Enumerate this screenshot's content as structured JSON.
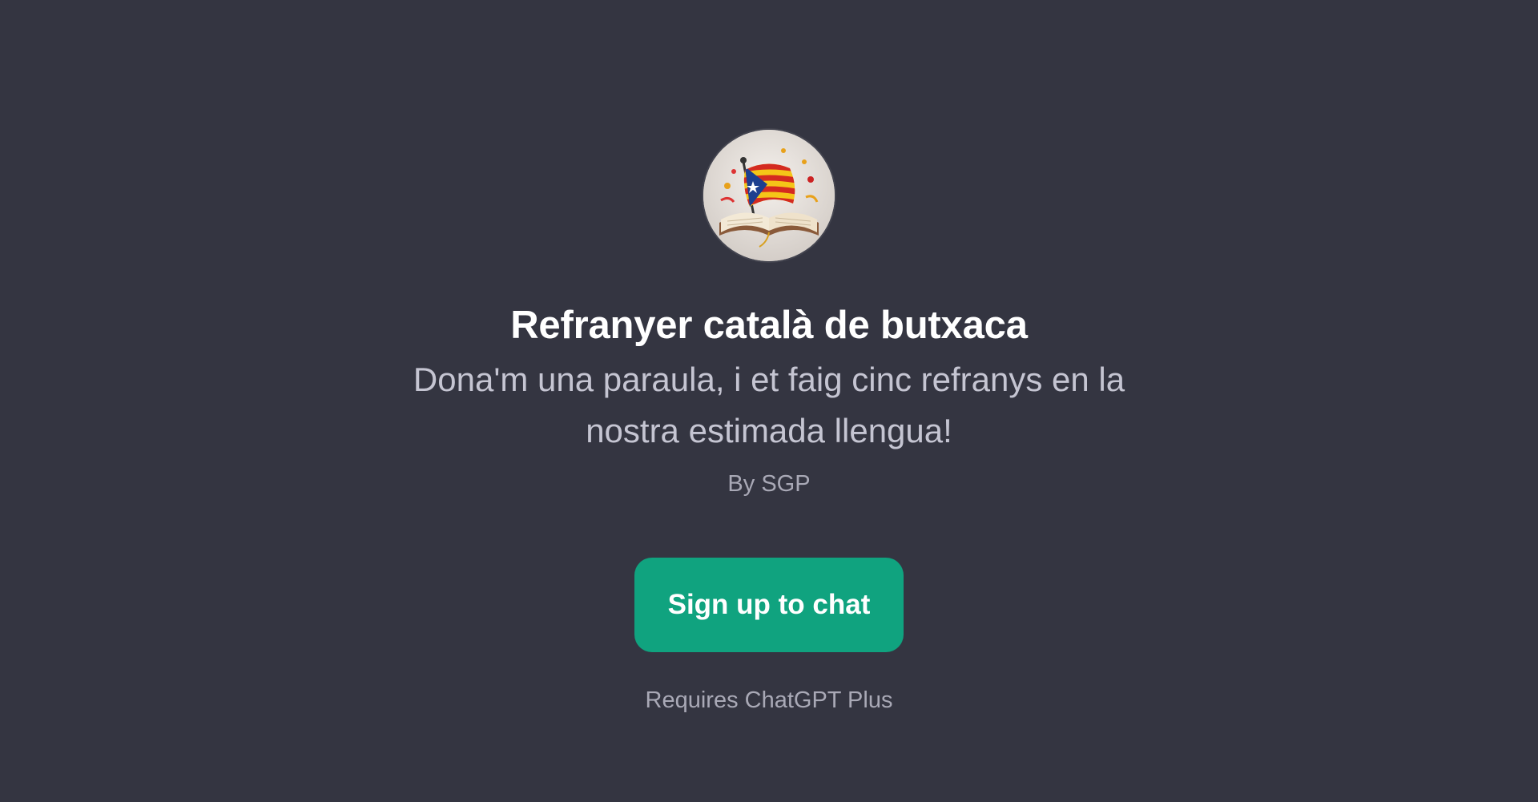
{
  "gpt": {
    "avatar_icon": "book-with-catalan-flag-icon",
    "title": "Refranyer català de butxaca",
    "description": "Dona'm una paraula, i et faig cinc refranys en la nostra estimada llengua!",
    "author": "By SGP"
  },
  "actions": {
    "signup_label": "Sign up to chat",
    "requirement": "Requires ChatGPT Plus"
  },
  "colors": {
    "background": "#343541",
    "accent": "#10a37f",
    "title": "#ffffff",
    "muted": "#a9a9b6"
  }
}
